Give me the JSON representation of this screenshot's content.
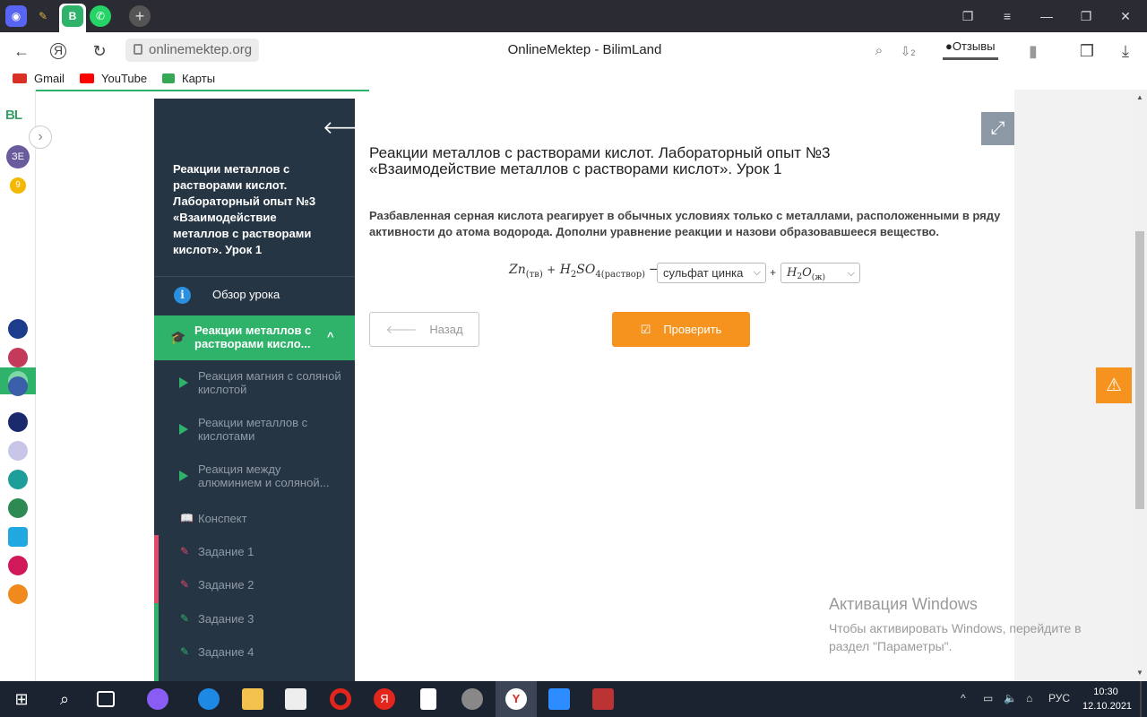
{
  "browser": {
    "tabs": [
      "discord",
      "feather",
      "bilimland",
      "whatsapp"
    ],
    "url": "onlinemektep.org",
    "title": "OnlineMektep - BilimLand",
    "reviews_label": "Отзывы",
    "downloads_count": "2"
  },
  "bookmarks": [
    {
      "label": "Gmail",
      "icon": "gmail-icon",
      "color": "#d93025"
    },
    {
      "label": "YouTube",
      "icon": "youtube-icon",
      "color": "#ff0000"
    },
    {
      "label": "Карты",
      "icon": "maps-icon",
      "color": "#34a853"
    }
  ],
  "rail": {
    "logo": "BL",
    "avatar": "ЗЕ",
    "badge": "9"
  },
  "lesson": {
    "title": "Реакции металлов с растворами кислот. Лабораторный опыт №3 «Взаимодействие металлов с растворами кислот». Урок 1",
    "overview": "Обзор урока",
    "current": "Реакции металлов с растворами кисло...",
    "subtopics": [
      "Реакция магния с соляной кислотой",
      "Реакции металлов с кислотами",
      "Реакция между алюминием и соляной..."
    ],
    "summary": "Конспект",
    "tasks": [
      "Задание 1",
      "Задание 2",
      "Задание 3",
      "Задание 4"
    ]
  },
  "main": {
    "heading": "Реакции металлов с растворами кислот. Лабораторный опыт №3 «Взаимодействие металлов с растворами кислот». Урок 1",
    "task_text": "Разбавленная серная кислота реагирует в обычных условиях только с металлами, расположенными в ряду активности до атома водорода. Дополни уравнение реакции и назови образовавшееся вещество.",
    "equation": {
      "zn": "Zn",
      "zn_state": "(тв)",
      "plus": "+",
      "h2so4_h": "H",
      "h2so4_2": "2",
      "h2so4_so": "SO",
      "h2so4_4": "4",
      "h2so4_state": "(раствор)",
      "arrow": "→",
      "select1_value": "сульфат цинка",
      "select2_h": "H",
      "select2_2": "2",
      "select2_o": "O",
      "select2_state": "(ж)"
    },
    "back_label": "Назад",
    "check_label": "Проверить"
  },
  "watermark": {
    "title": "Активация Windows",
    "line1": "Чтобы активировать Windows, перейдите в",
    "line2": "раздел \"Параметры\"."
  },
  "taskbar": {
    "lang": "РУС",
    "time": "10:30",
    "date": "12.10.2021"
  },
  "colors": {
    "accent_green": "#2fb36b",
    "sidebar_bg": "#263544",
    "orange": "#f6921e",
    "task_mark_red": "#e04a68"
  }
}
